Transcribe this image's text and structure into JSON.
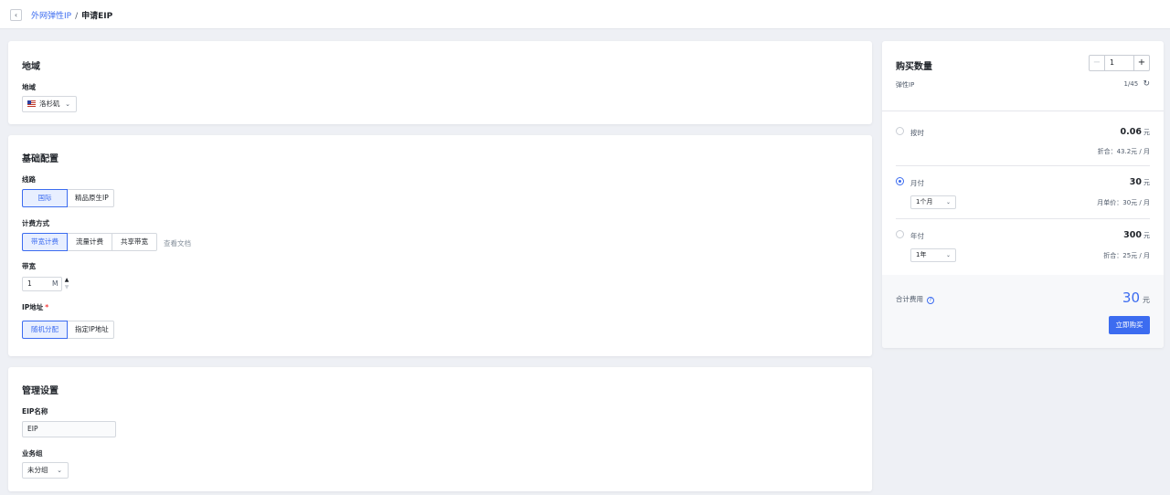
{
  "breadcrumb": {
    "back_icon": "chevron-left-icon",
    "parent": "外网弹性IP",
    "separator": "/",
    "current": "申请EIP"
  },
  "region": {
    "title": "地域",
    "label": "地域",
    "value": "洛杉矶",
    "flag_icon": "us-flag-icon"
  },
  "basic": {
    "title": "基础配置",
    "line_label": "线路",
    "line_options": [
      "国际",
      "精品原生IP"
    ],
    "line_selected": "国际",
    "billing_label": "计费方式",
    "billing_options": [
      "带宽计费",
      "流量计费",
      "共享带宽"
    ],
    "billing_selected": "带宽计费",
    "doc_link": "查看文档",
    "bandwidth_label": "带宽",
    "bandwidth_value": "1",
    "bandwidth_unit": "M",
    "ip_label": "IP地址",
    "ip_required": "*",
    "ip_options": [
      "随机分配",
      "指定IP地址"
    ],
    "ip_selected": "随机分配"
  },
  "manage": {
    "title": "管理设置",
    "eip_name_label": "EIP名称",
    "eip_name_value": "EIP",
    "group_label": "业务组",
    "group_value": "未分组"
  },
  "purchase": {
    "title": "购买数量",
    "quantity": "1",
    "minus": "−",
    "plus": "+",
    "quota_label": "弹性IP",
    "quota_value": "1/45",
    "options": [
      {
        "label": "按时",
        "price": "0.06",
        "unit": "元",
        "note": "折合：43.2元 / 月",
        "selected": false
      },
      {
        "label": "月付",
        "price": "30",
        "unit": "元",
        "period": "1个月",
        "note": "月单价：30元 / 月",
        "selected": true
      },
      {
        "label": "年付",
        "price": "300",
        "unit": "元",
        "period": "1年",
        "note": "折合：25元 / 月",
        "selected": false
      }
    ],
    "total_label": "合计费用",
    "total_value": "30",
    "total_unit": "元",
    "buy_button": "立即购买"
  },
  "colors": {
    "accent": "#3c6cf0",
    "background": "#eef0f5",
    "required": "#f53f3f"
  }
}
